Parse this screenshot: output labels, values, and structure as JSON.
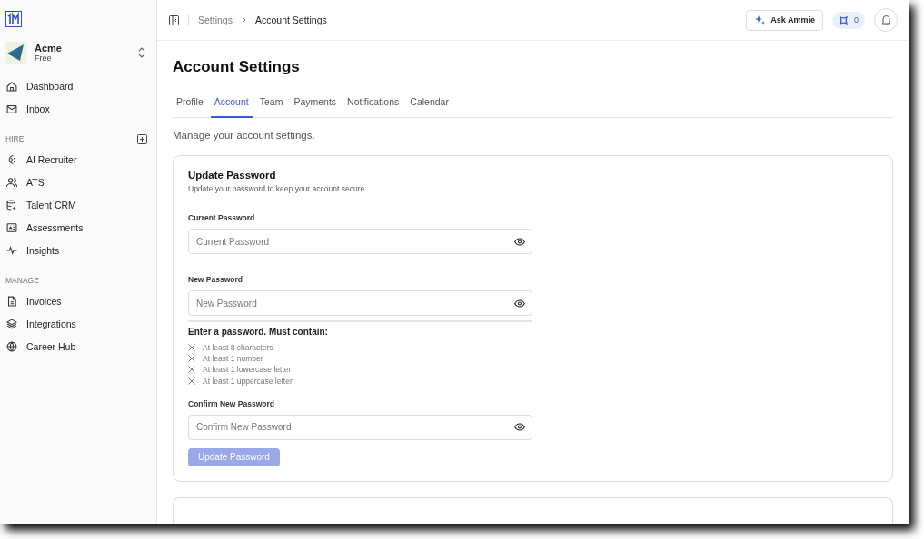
{
  "sidebar": {
    "workspace": {
      "name": "Acme",
      "plan": "Free"
    },
    "items": [
      {
        "label": "Dashboard",
        "selected": false
      },
      {
        "label": "Inbox",
        "selected": false
      }
    ],
    "sections": [
      {
        "title": "HIRE",
        "addable": true,
        "items": [
          {
            "label": "AI Recruiter",
            "selected": false
          },
          {
            "label": "ATS",
            "selected": false
          },
          {
            "label": "Talent CRM",
            "selected": false
          },
          {
            "label": "Assessments",
            "selected": false
          },
          {
            "label": "Insights",
            "selected": false
          }
        ]
      },
      {
        "title": "MANAGE",
        "addable": false,
        "items": [
          {
            "label": "Invoices",
            "selected": false
          },
          {
            "label": "Integrations",
            "selected": false
          },
          {
            "label": "Career Hub",
            "selected": false
          }
        ]
      }
    ]
  },
  "breadcrumb": [
    "Settings",
    "Account Settings"
  ],
  "header": {
    "ask_button": "Ask Ammie",
    "credits": "0"
  },
  "page_title": "Account Settings",
  "tabs": [
    {
      "label": "Profile",
      "selected": false
    },
    {
      "label": "Account",
      "selected": true
    },
    {
      "label": "Team",
      "selected": false
    },
    {
      "label": "Payments",
      "selected": false
    },
    {
      "label": "Notifications",
      "selected": false
    },
    {
      "label": "Calendar",
      "selected": false
    }
  ],
  "intro": "Manage your account settings.",
  "card": {
    "title": "Update Password",
    "subtitle": "Update your password to keep your account secure.",
    "fields": [
      {
        "label": "Current Password",
        "placeholder": "Current Password"
      },
      {
        "label": "New Password",
        "placeholder": "New Password",
        "strength_meter": true
      },
      {
        "label": "Confirm New Password",
        "placeholder": "Confirm New Password"
      }
    ],
    "requirements_title": "Enter a password. Must contain:",
    "requirements": [
      {
        "text": "At least 8 characters",
        "met": false
      },
      {
        "text": "At least 1 number",
        "met": false
      },
      {
        "text": "At least 1 lowercase letter",
        "met": false
      },
      {
        "text": "At least 1 uppercase letter",
        "met": false
      }
    ],
    "submit": {
      "label": "Update Password",
      "disabled": true
    }
  }
}
